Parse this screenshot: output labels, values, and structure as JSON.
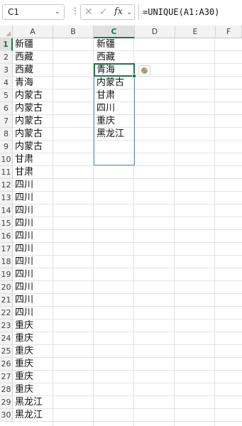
{
  "formula_bar": {
    "name_box": "C1",
    "name_box_chevron": "⌄",
    "separator": "⋮",
    "cancel_glyph": "✕",
    "enter_glyph": "✓",
    "fx_label": "fx",
    "fx_chevron": "⌄",
    "formula": "=UNIQUE(A1:A30)"
  },
  "columns": [
    "A",
    "B",
    "C",
    "D",
    "E",
    "F"
  ],
  "active_column": "C",
  "rows": [
    "1",
    "2",
    "3",
    "4",
    "5",
    "6",
    "7",
    "8",
    "9",
    "10",
    "11",
    "12",
    "13",
    "14",
    "15",
    "16",
    "17",
    "18",
    "19",
    "20",
    "21",
    "22",
    "23",
    "24",
    "25",
    "26",
    "27",
    "28",
    "29",
    "30"
  ],
  "active_row": "1",
  "column_a": [
    "新疆",
    "西藏",
    "西藏",
    "青海",
    "内蒙古",
    "内蒙古",
    "内蒙古",
    "内蒙古",
    "内蒙古",
    "甘肃",
    "甘肃",
    "四川",
    "四川",
    "四川",
    "四川",
    "四川",
    "四川",
    "四川",
    "四川",
    "四川",
    "四川",
    "四川",
    "重庆",
    "重庆",
    "重庆",
    "重庆",
    "重庆",
    "重庆",
    "黑龙江",
    "黑龙江"
  ],
  "column_c": [
    "新疆",
    "西藏",
    "青海",
    "内蒙古",
    "甘肃",
    "四川",
    "重庆",
    "黑龙江"
  ],
  "icons": {
    "quick_analysis": "quick-analysis-icon",
    "select_all": "select-all-triangle-icon"
  },
  "colors": {
    "accent_green": "#217346",
    "spill_border": "#5b8fc9"
  }
}
